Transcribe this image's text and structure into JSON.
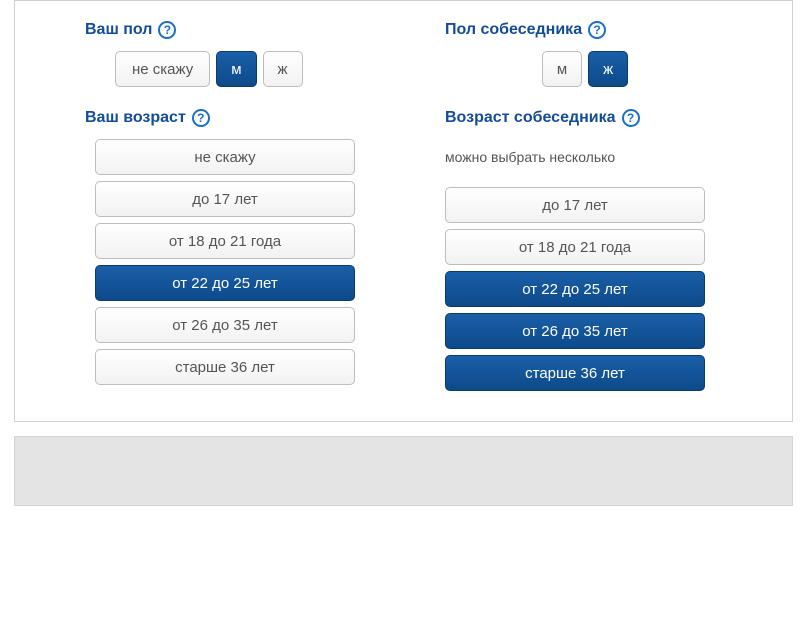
{
  "left": {
    "gender": {
      "heading": "Ваш пол",
      "help_icon": "?",
      "options": [
        {
          "label": "не скажу",
          "selected": false
        },
        {
          "label": "м",
          "selected": true
        },
        {
          "label": "ж",
          "selected": false
        }
      ]
    },
    "age": {
      "heading": "Ваш возраст",
      "help_icon": "?",
      "options": [
        {
          "label": "не скажу",
          "selected": false
        },
        {
          "label": "до 17 лет",
          "selected": false
        },
        {
          "label": "от 18 до 21 года",
          "selected": false
        },
        {
          "label": "от 22 до 25 лет",
          "selected": true
        },
        {
          "label": "от 26 до 35 лет",
          "selected": false
        },
        {
          "label": "старше 36 лет",
          "selected": false
        }
      ]
    }
  },
  "right": {
    "gender": {
      "heading": "Пол собеседника",
      "help_icon": "?",
      "options": [
        {
          "label": "м",
          "selected": false
        },
        {
          "label": "ж",
          "selected": true
        }
      ]
    },
    "age": {
      "heading": "Возраст собеседника",
      "help_icon": "?",
      "hint": "можно выбрать несколько",
      "options": [
        {
          "label": "до 17 лет",
          "selected": false
        },
        {
          "label": "от 18 до 21 года",
          "selected": false
        },
        {
          "label": "от 22 до 25 лет",
          "selected": true
        },
        {
          "label": "от 26 до 35 лет",
          "selected": true
        },
        {
          "label": "старше 36 лет",
          "selected": true
        }
      ]
    }
  }
}
